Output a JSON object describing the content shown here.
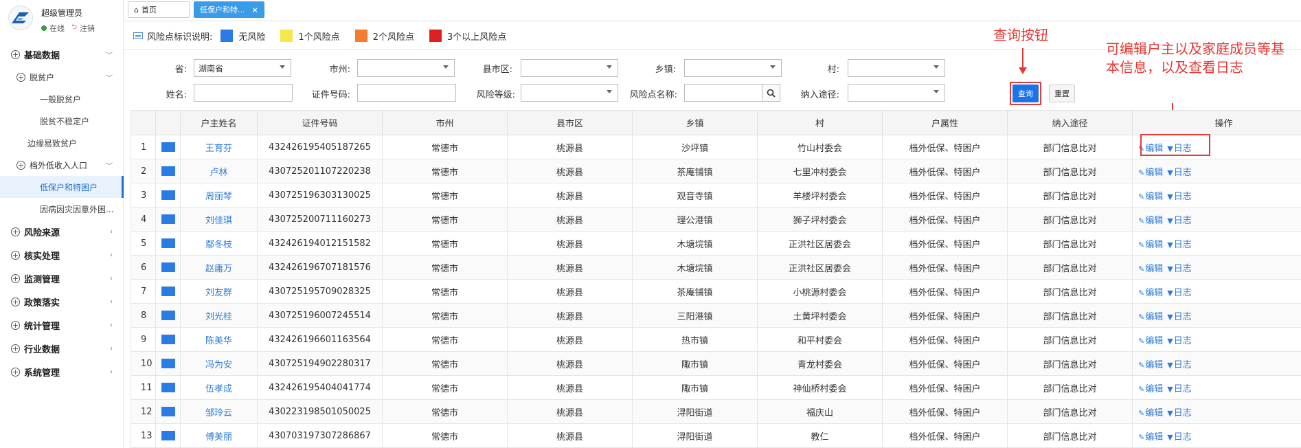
{
  "colors": {
    "accent": "#1a73e8",
    "no_risk": "#2b7be6",
    "one_risk": "#f7e84a",
    "two_risk": "#f57c2f",
    "three_risk": "#e02020",
    "annotation": "#e53935"
  },
  "user": {
    "name": "超级管理员",
    "status": "在线",
    "logout": "注销"
  },
  "menu": {
    "base_data": "基础数据",
    "poverty_relief": "脱贫户",
    "general_relief": "一般脱贫户",
    "unstable": "脱贫不稳定户",
    "edge_poverty": "边缘易致贫户",
    "low_income": "档外低收入人口",
    "low_security": "低保户和特困户",
    "disaster": "因病因灾因意外困...",
    "risk_source": "风险来源",
    "verify": "核实处理",
    "monitor": "监测管理",
    "policy": "政策落实",
    "stats": "统计管理",
    "industry": "行业数据",
    "system": "系统管理"
  },
  "tabs": {
    "home": "首页",
    "active": "低保户和特...",
    "close": "×"
  },
  "legend": {
    "title": "风险点标识说明:",
    "none": "无风险",
    "one": "1个风险点",
    "two": "2个风险点",
    "three": "3个以上风险点"
  },
  "filters": {
    "province_label": "省:",
    "province_value": "湖南省",
    "city_label": "市州:",
    "county_label": "县市区:",
    "town_label": "乡镇:",
    "village_label": "村:",
    "name_label": "姓名:",
    "id_label": "证件号码:",
    "level_label": "风险等级:",
    "point_label": "风险点名称:",
    "way_label": "纳入途径:",
    "query": "查询",
    "reset": "重置"
  },
  "annotations": {
    "query_note": "查询按钮",
    "edit_note_1": "可编辑户主以及家庭成员等基",
    "edit_note_2": "本信息，以及查看日志"
  },
  "table": {
    "headers": [
      "",
      "",
      "户主姓名",
      "证件号码",
      "市州",
      "县市区",
      "乡镇",
      "村",
      "户属性",
      "纳入途径",
      "操作"
    ],
    "edit_label": "编辑",
    "log_label": "日志",
    "rows": [
      {
        "no": "1",
        "name": "王育芬",
        "id": "432426195405187265",
        "city": "常德市",
        "county": "桃源县",
        "town": "沙坪镇",
        "village": "竹山村委会",
        "attr": "档外低保、特困户",
        "way": "部门信息比对"
      },
      {
        "no": "2",
        "name": "卢林",
        "id": "430725201107220238",
        "city": "常德市",
        "county": "桃源县",
        "town": "茶庵铺镇",
        "village": "七里冲村委会",
        "attr": "档外低保、特困户",
        "way": "部门信息比对"
      },
      {
        "no": "3",
        "name": "周丽琴",
        "id": "430725196303130025",
        "city": "常德市",
        "county": "桃源县",
        "town": "观音寺镇",
        "village": "羊楼坪村委会",
        "attr": "档外低保、特困户",
        "way": "部门信息比对"
      },
      {
        "no": "4",
        "name": "刘佳琪",
        "id": "430725200711160273",
        "city": "常德市",
        "county": "桃源县",
        "town": "理公港镇",
        "village": "狮子坪村委会",
        "attr": "档外低保、特困户",
        "way": "部门信息比对"
      },
      {
        "no": "5",
        "name": "鄢冬枝",
        "id": "432426194012151582",
        "city": "常德市",
        "county": "桃源县",
        "town": "木塘垸镇",
        "village": "正洪社区居委会",
        "attr": "档外低保、特困户",
        "way": "部门信息比对"
      },
      {
        "no": "6",
        "name": "赵庸万",
        "id": "432426196707181576",
        "city": "常德市",
        "county": "桃源县",
        "town": "木塘垸镇",
        "village": "正洪社区居委会",
        "attr": "档外低保、特困户",
        "way": "部门信息比对"
      },
      {
        "no": "7",
        "name": "刘友群",
        "id": "430725195709028325",
        "city": "常德市",
        "county": "桃源县",
        "town": "茶庵铺镇",
        "village": "小桃源村委会",
        "attr": "档外低保、特困户",
        "way": "部门信息比对"
      },
      {
        "no": "8",
        "name": "刘光桂",
        "id": "430725196007245514",
        "city": "常德市",
        "county": "桃源县",
        "town": "三阳港镇",
        "village": "土黄坪村委会",
        "attr": "档外低保、特困户",
        "way": "部门信息比对"
      },
      {
        "no": "9",
        "name": "陈美华",
        "id": "432426196601163564",
        "city": "常德市",
        "county": "桃源县",
        "town": "热市镇",
        "village": "和平村委会",
        "attr": "档外低保、特困户",
        "way": "部门信息比对"
      },
      {
        "no": "10",
        "name": "冯为安",
        "id": "430725194902280317",
        "city": "常德市",
        "county": "桃源县",
        "town": "陬市镇",
        "village": "青龙村委会",
        "attr": "档外低保、特困户",
        "way": "部门信息比对"
      },
      {
        "no": "11",
        "name": "伍孝成",
        "id": "432426195404041774",
        "city": "常德市",
        "county": "桃源县",
        "town": "陬市镇",
        "village": "神仙桥村委会",
        "attr": "档外低保、特困户",
        "way": "部门信息比对"
      },
      {
        "no": "12",
        "name": "邹玲云",
        "id": "430223198501050025",
        "city": "常德市",
        "county": "桃源县",
        "town": "浔阳街道",
        "village": "福庆山",
        "attr": "档外低保、特困户",
        "way": "部门信息比对"
      },
      {
        "no": "13",
        "name": "傅美丽",
        "id": "430703197307286867",
        "city": "常德市",
        "county": "桃源县",
        "town": "浔阳街道",
        "village": "教仁",
        "attr": "档外低保、特困户",
        "way": "部门信息比对"
      }
    ]
  }
}
